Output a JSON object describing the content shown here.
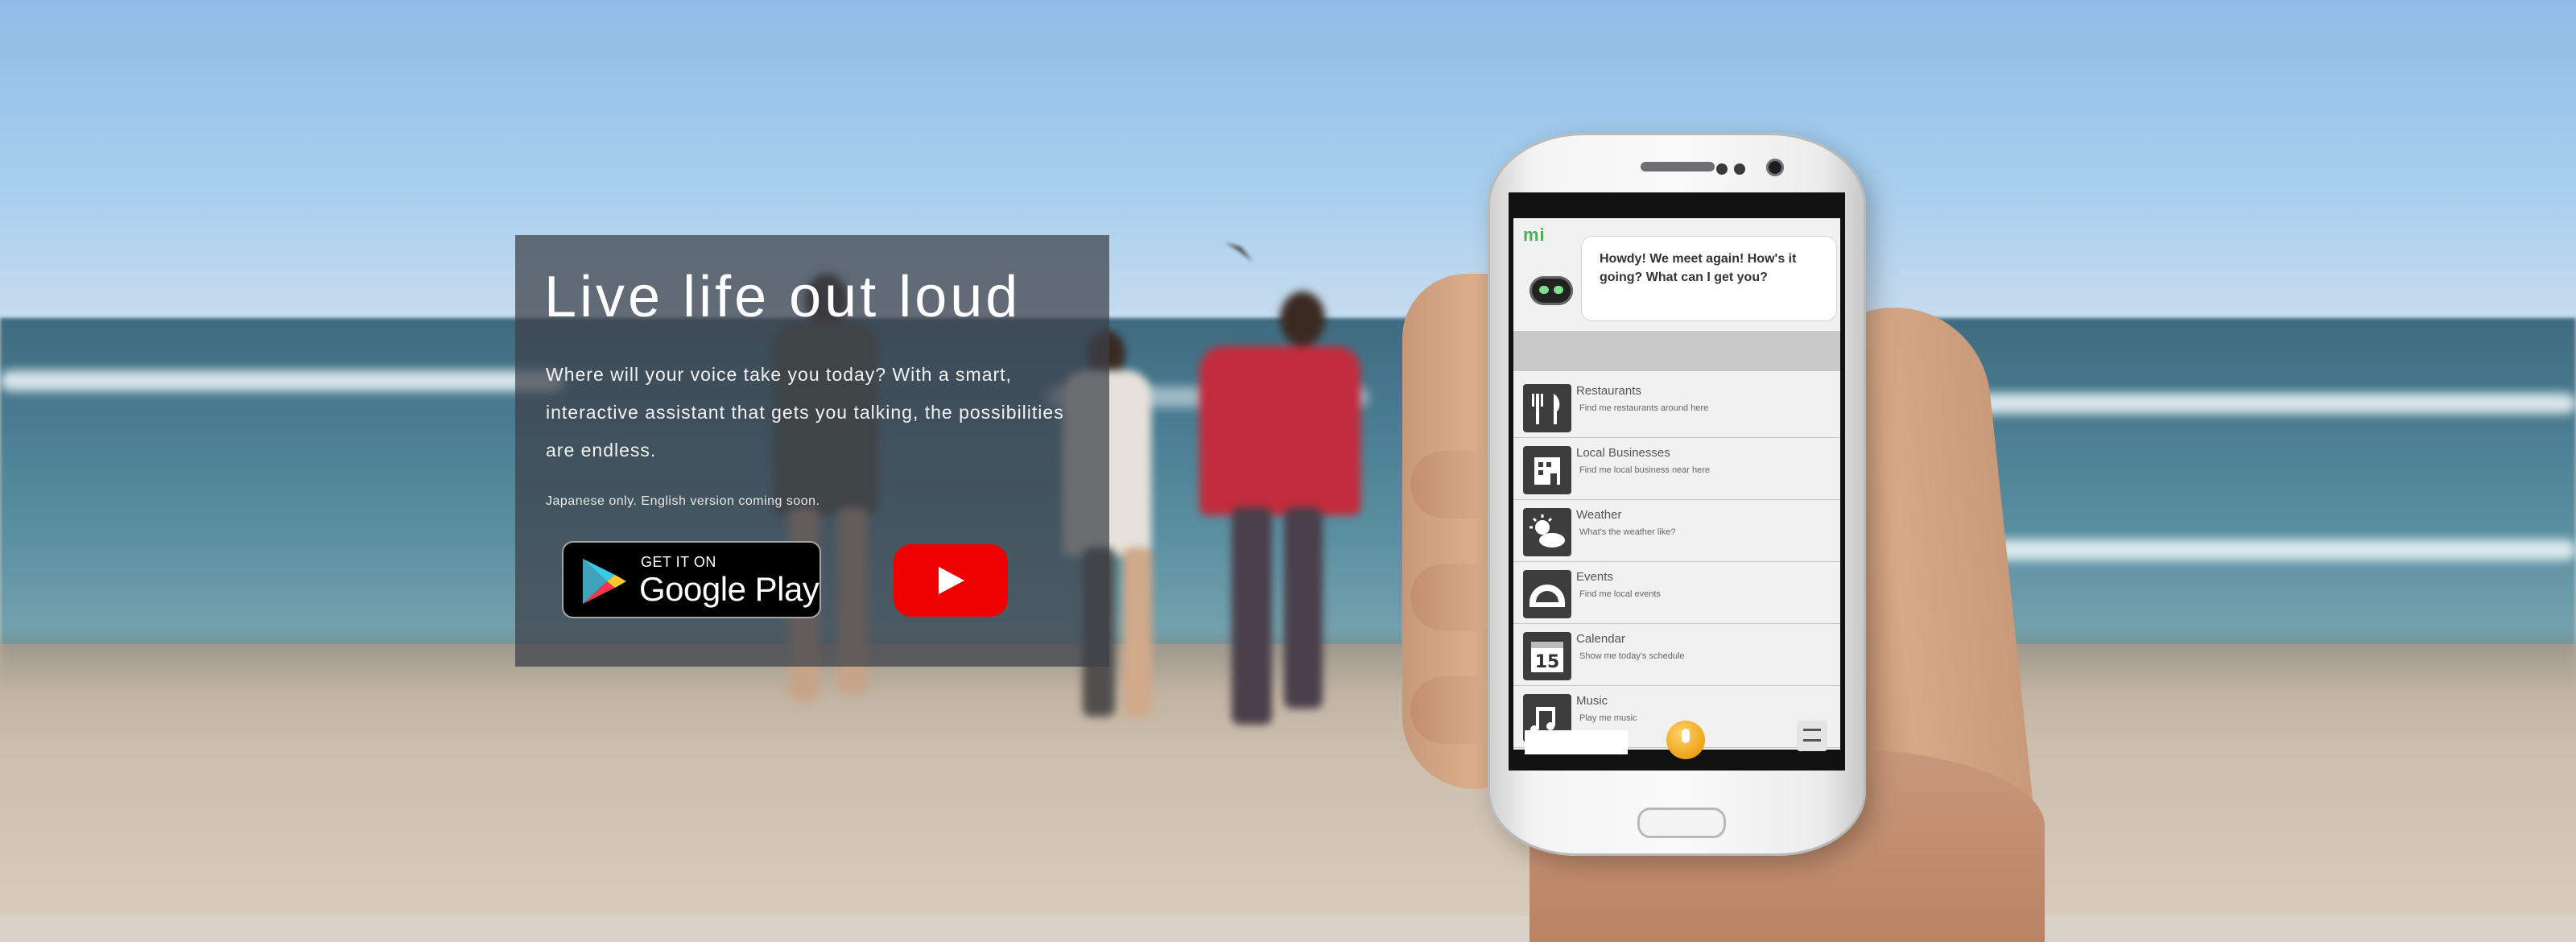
{
  "hero": {
    "title": "Live life out loud",
    "body": "Where will your voice take you today? With a smart, interactive assistant that gets you talking, the possibilities are endless.",
    "note": "Japanese only. English version coming soon.",
    "google_play": {
      "small": "GET IT ON",
      "big": "Google Play"
    },
    "youtube_icon": "youtube-play-icon"
  },
  "phone": {
    "app_logo": "mi",
    "greeting": "Howdy! We meet again! How's it going? What can I get you?",
    "items": [
      {
        "title": "Restaurants",
        "subtitle": "Find me restaurants around here",
        "icon": "fork-knife-icon"
      },
      {
        "title": "Local Businesses",
        "subtitle": "Find me local business near here",
        "icon": "building-icon"
      },
      {
        "title": "Weather",
        "subtitle": "What's the weather like?",
        "icon": "weather-icon"
      },
      {
        "title": "Events",
        "subtitle": "Find me local events",
        "icon": "stadium-icon"
      },
      {
        "title": "Calendar",
        "subtitle": "Show me today's schedule",
        "icon": "calendar-icon",
        "glyph": "15"
      },
      {
        "title": "Music",
        "subtitle": "Play me music",
        "icon": "music-icon"
      }
    ]
  },
  "colors": {
    "hero_bg": "#3c4048",
    "youtube_red": "#ee0000",
    "mic_orange": "#f0a21a",
    "app_green": "#4bb05b"
  }
}
